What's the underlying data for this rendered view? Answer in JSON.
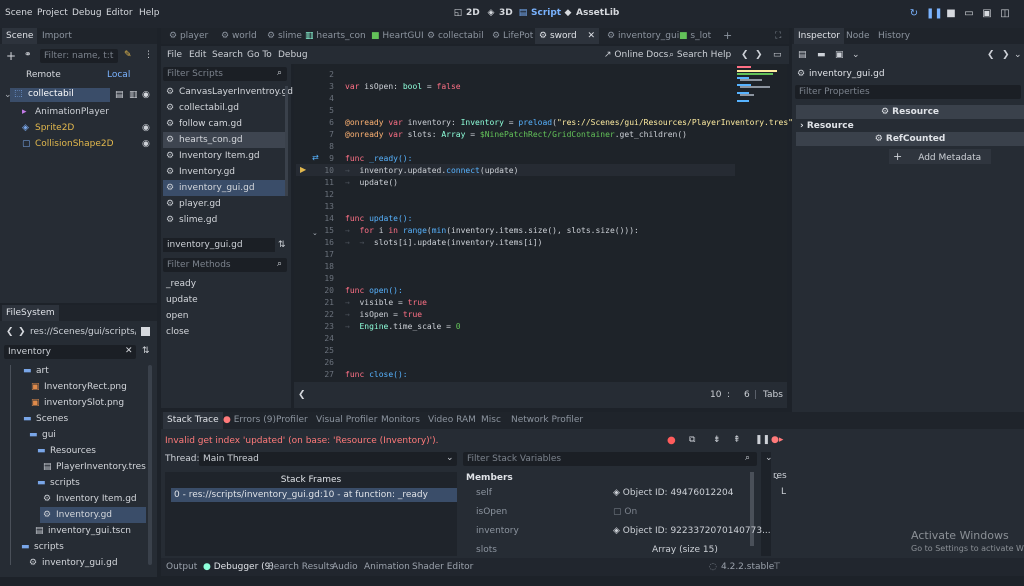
{
  "top_menu": [
    "Scene",
    "Project",
    "Debug",
    "Editor",
    "Help"
  ],
  "workspaces": [
    {
      "label": "2D",
      "icon": "2d-icon"
    },
    {
      "label": "3D",
      "icon": "3d-icon"
    },
    {
      "label": "Script",
      "icon": "script-icon",
      "active": true
    },
    {
      "label": "AssetLib",
      "icon": "assetlib-icon"
    }
  ],
  "scene_dock": {
    "tabs": [
      "Scene",
      "Import"
    ],
    "filter_placeholder": "Filter: name, t:t",
    "mode_remote": "Remote",
    "mode_local": "Local",
    "tree": [
      {
        "label": "collectabil",
        "kind": "root"
      },
      {
        "label": "AnimationPlayer",
        "kind": "child"
      },
      {
        "label": "Sprite2D",
        "kind": "child"
      },
      {
        "label": "CollisionShape2D",
        "kind": "child"
      }
    ]
  },
  "filesystem": {
    "tab": "FileSystem",
    "path": "res://Scenes/gui/scripts/Inv",
    "search_value": "Inventory",
    "items": [
      {
        "label": "art",
        "kind": "folder",
        "indent": 1
      },
      {
        "label": "InventoryRect.png",
        "kind": "img",
        "indent": 2
      },
      {
        "label": "inventorySlot.png",
        "kind": "img",
        "indent": 2
      },
      {
        "label": "Scenes",
        "kind": "folder",
        "indent": 1
      },
      {
        "label": "gui",
        "kind": "folder",
        "indent": 2
      },
      {
        "label": "Resources",
        "kind": "folder",
        "indent": 3
      },
      {
        "label": "PlayerInventory.tres",
        "kind": "file",
        "indent": 4
      },
      {
        "label": "scripts",
        "kind": "folder",
        "indent": 3
      },
      {
        "label": "Inventory Item.gd",
        "kind": "gear",
        "indent": 4
      },
      {
        "label": "Inventory.gd",
        "kind": "gear",
        "indent": 4,
        "selected": true
      },
      {
        "label": "inventory_gui.tscn",
        "kind": "file",
        "indent": 3
      },
      {
        "label": "scripts",
        "kind": "folder",
        "indent": 1
      },
      {
        "label": "inventory_gui.gd",
        "kind": "gear",
        "indent": 2
      }
    ]
  },
  "editor_tabs": [
    "player",
    "world",
    "slime",
    "hearts_con",
    "HeartGUI",
    "collectabil",
    "LifePot",
    "sword",
    "inventory_gui",
    "s_lot"
  ],
  "script_menu": [
    "File",
    "Edit",
    "Search",
    "Go To",
    "Debug"
  ],
  "online_docs": "Online Docs",
  "search_help": "Search Help",
  "scripts_filter_placeholder": "Filter Scripts",
  "scripts_list": [
    "CanvasLayerInventroy.gd",
    "collectabil.gd",
    "follow cam.gd",
    "hearts_con.gd",
    "Inventory Item.gd",
    "Inventory.gd",
    "inventory_gui.gd",
    "player.gd",
    "slime.gd"
  ],
  "current_script": "inventory_gui.gd",
  "methods_filter_placeholder": "Filter Methods",
  "methods": [
    "_ready",
    "update",
    "open",
    "close"
  ],
  "code_lines": [
    {
      "n": "2"
    },
    {
      "n": "3"
    },
    {
      "n": "4"
    },
    {
      "n": "5"
    },
    {
      "n": "6"
    },
    {
      "n": "7"
    },
    {
      "n": "8"
    },
    {
      "n": "9"
    },
    {
      "n": "10"
    },
    {
      "n": "11"
    },
    {
      "n": "12"
    },
    {
      "n": "13"
    },
    {
      "n": "14"
    },
    {
      "n": "15"
    },
    {
      "n": "16"
    },
    {
      "n": "17"
    },
    {
      "n": "18"
    },
    {
      "n": "19"
    },
    {
      "n": "20"
    },
    {
      "n": "21"
    },
    {
      "n": "22"
    },
    {
      "n": "23"
    },
    {
      "n": "24"
    },
    {
      "n": "25"
    },
    {
      "n": "26"
    },
    {
      "n": "27"
    }
  ],
  "code_text": {
    "l3_a": "var",
    "l3_b": " isOpen: ",
    "l3_c": "bool",
    "l3_d": " = ",
    "l3_e": "false",
    "l5_a": "@onready",
    "l5_b": " var",
    "l5_c": " inventory: ",
    "l5_d": "Inventory",
    "l5_e": " = ",
    "l5_f": "preload",
    "l5_g": "(",
    "l5_h": "\"res://Scenes/gui/Resources/PlayerInventory.tres\"",
    "l5_i": ")",
    "l6_a": "@onready",
    "l6_b": " var",
    "l6_c": " slots: ",
    "l6_d": "Array",
    "l6_e": " = ",
    "l6_f": "$NinePatchRect/GridContainer",
    "l6_g": ".get_children()",
    "l9_a": "func",
    "l9_b": " _ready():",
    "l10": "inventory.updated.",
    "l10_b": "connect",
    "l10_c": "(update)",
    "l11": "update()",
    "l14_a": "func",
    "l14_b": " update():",
    "l15_a": "for",
    "l15_b": " i ",
    "l15_c": "in",
    "l15_d": " range",
    "l15_e": "(",
    "l15_f": "min",
    "l15_g": "(inventory.items.size(), slots.size())):",
    "l16": "slots[i].update(inventory.items[i])",
    "l19_a": "func",
    "l19_b": " open():",
    "l20_a": "visible = ",
    "l20_b": "true",
    "l21_a": "isOpen = ",
    "l21_b": "true",
    "l22_a": "Engine",
    "l22_b": ".time_scale = ",
    "l22_c": "0",
    "l26_a": "func",
    "l26_b": " close():"
  },
  "status": {
    "line": "10",
    "col": "6",
    "indent": "Tabs",
    "sep": ":",
    "bar": "|"
  },
  "inspector": {
    "tabs": [
      "Inspector",
      "Node",
      "History"
    ],
    "object": "inventory_gui.gd",
    "filter_placeholder": "Filter Properties",
    "section_resource": "Resource",
    "sub_resource": "Resource",
    "section_refcounted": "RefCounted",
    "add_metadata": "Add Metadata"
  },
  "debugger": {
    "tabs": [
      "Stack Trace",
      "Errors (9)",
      "Profiler",
      "Visual Profiler",
      "Monitors",
      "Video RAM",
      "Misc",
      "Network Profiler"
    ],
    "error": "Invalid get index 'updated' (on base: 'Resource (Inventory)').",
    "thread_label": "Thread:",
    "thread_value": "Main Thread",
    "stack_header": "Stack Frames",
    "frame": "0 - res://scripts/inventory_gui.gd:10 - at function: _ready",
    "vars_filter_placeholder": "Filter Stack Variables",
    "members_header": "Members",
    "members": [
      {
        "name": "self",
        "value": "Object ID: 49476012204"
      },
      {
        "name": "isOpen",
        "value": "On"
      },
      {
        "name": "inventory",
        "value": "Object ID: 9223372070140773..."
      },
      {
        "name": "slots",
        "value": "Array (size 15)"
      }
    ],
    "right_stub": "res",
    "right_stub2": "L"
  },
  "bottom_bar": {
    "tabs": [
      "Output",
      "Debugger (9)",
      "Search Results",
      "Audio",
      "Animation",
      "Shader Editor"
    ],
    "version": "4.2.2.stable"
  },
  "watermark": {
    "title": "Activate Windows",
    "subtitle": "Go to Settings to activate Windows."
  },
  "colors": {
    "accent": "#7ab3ff",
    "error": "#ff7a7a",
    "selection": "#3a4d69"
  }
}
